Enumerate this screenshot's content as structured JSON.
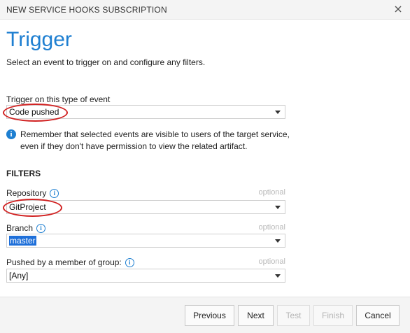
{
  "dialog": {
    "title": "NEW SERVICE HOOKS SUBSCRIPTION",
    "close_icon": "close-icon"
  },
  "page": {
    "heading": "Trigger",
    "subheading": "Select an event to trigger on and configure any filters."
  },
  "trigger": {
    "label": "Trigger on this type of event",
    "value": "Code pushed"
  },
  "notice": {
    "icon": "info-icon",
    "line1": "Remember that selected events are visible to users of the target service,",
    "line2": "even if they don't have permission to view the related artifact."
  },
  "filters": {
    "title": "FILTERS",
    "repository": {
      "label": "Repository",
      "optional": "optional",
      "value": "GitProject"
    },
    "branch": {
      "label": "Branch",
      "optional": "optional",
      "value": "master"
    },
    "group": {
      "label": "Pushed by a member of group:",
      "optional": "optional",
      "value": "[Any]"
    }
  },
  "buttons": {
    "previous": "Previous",
    "next": "Next",
    "test": "Test",
    "finish": "Finish",
    "cancel": "Cancel"
  },
  "colors": {
    "heading": "#1e7fd1",
    "annotation": "#d12222",
    "selection": "#1e6fd9"
  }
}
